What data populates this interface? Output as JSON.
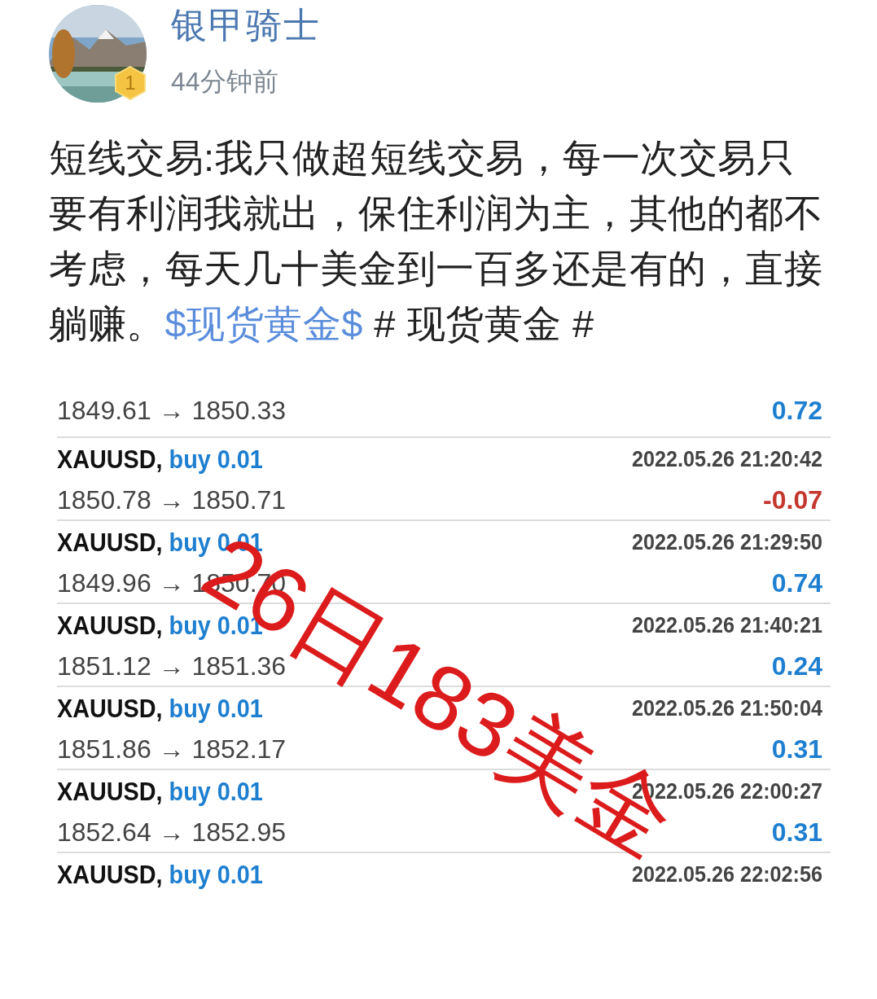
{
  "post": {
    "author": "银甲骑士",
    "badge": "1",
    "time": "44分钟前",
    "text": "短线交易:我只做超短线交易，每一次交易只要有利润我就出，保住利润为主，其他的都不考虑，每天几十美金到一百多还是有的，直接躺赚。",
    "stock_tag": "$现货黄金$",
    "topic": "# 现货黄金 #"
  },
  "trades": [
    {
      "prices": "1849.61 → 1850.33",
      "profit": "0.72",
      "negative": false
    },
    {
      "symbol": "XAUUSD,",
      "order": "buy 0.01",
      "time": "2022.05.26 21:20:42",
      "prices": "1850.78 → 1850.71",
      "profit": "-0.07",
      "negative": true
    },
    {
      "symbol": "XAUUSD,",
      "order": "buy 0.01",
      "time": "2022.05.26 21:29:50",
      "prices": "1849.96 → 1850.70",
      "profit": "0.74",
      "negative": false
    },
    {
      "symbol": "XAUUSD,",
      "order": "buy 0.01",
      "time": "2022.05.26 21:40:21",
      "prices": "1851.12 → 1851.36",
      "profit": "0.24",
      "negative": false
    },
    {
      "symbol": "XAUUSD,",
      "order": "buy 0.01",
      "time": "2022.05.26 21:50:04",
      "prices": "1851.86 → 1852.17",
      "profit": "0.31",
      "negative": false
    },
    {
      "symbol": "XAUUSD,",
      "order": "buy 0.01",
      "time": "2022.05.26 22:00:27",
      "prices": "1852.64 → 1852.95",
      "profit": "0.31",
      "negative": false
    },
    {
      "symbol": "XAUUSD,",
      "order": "buy 0.01",
      "time": "2022.05.26 22:02:56"
    }
  ],
  "overlay": "26日183美金"
}
